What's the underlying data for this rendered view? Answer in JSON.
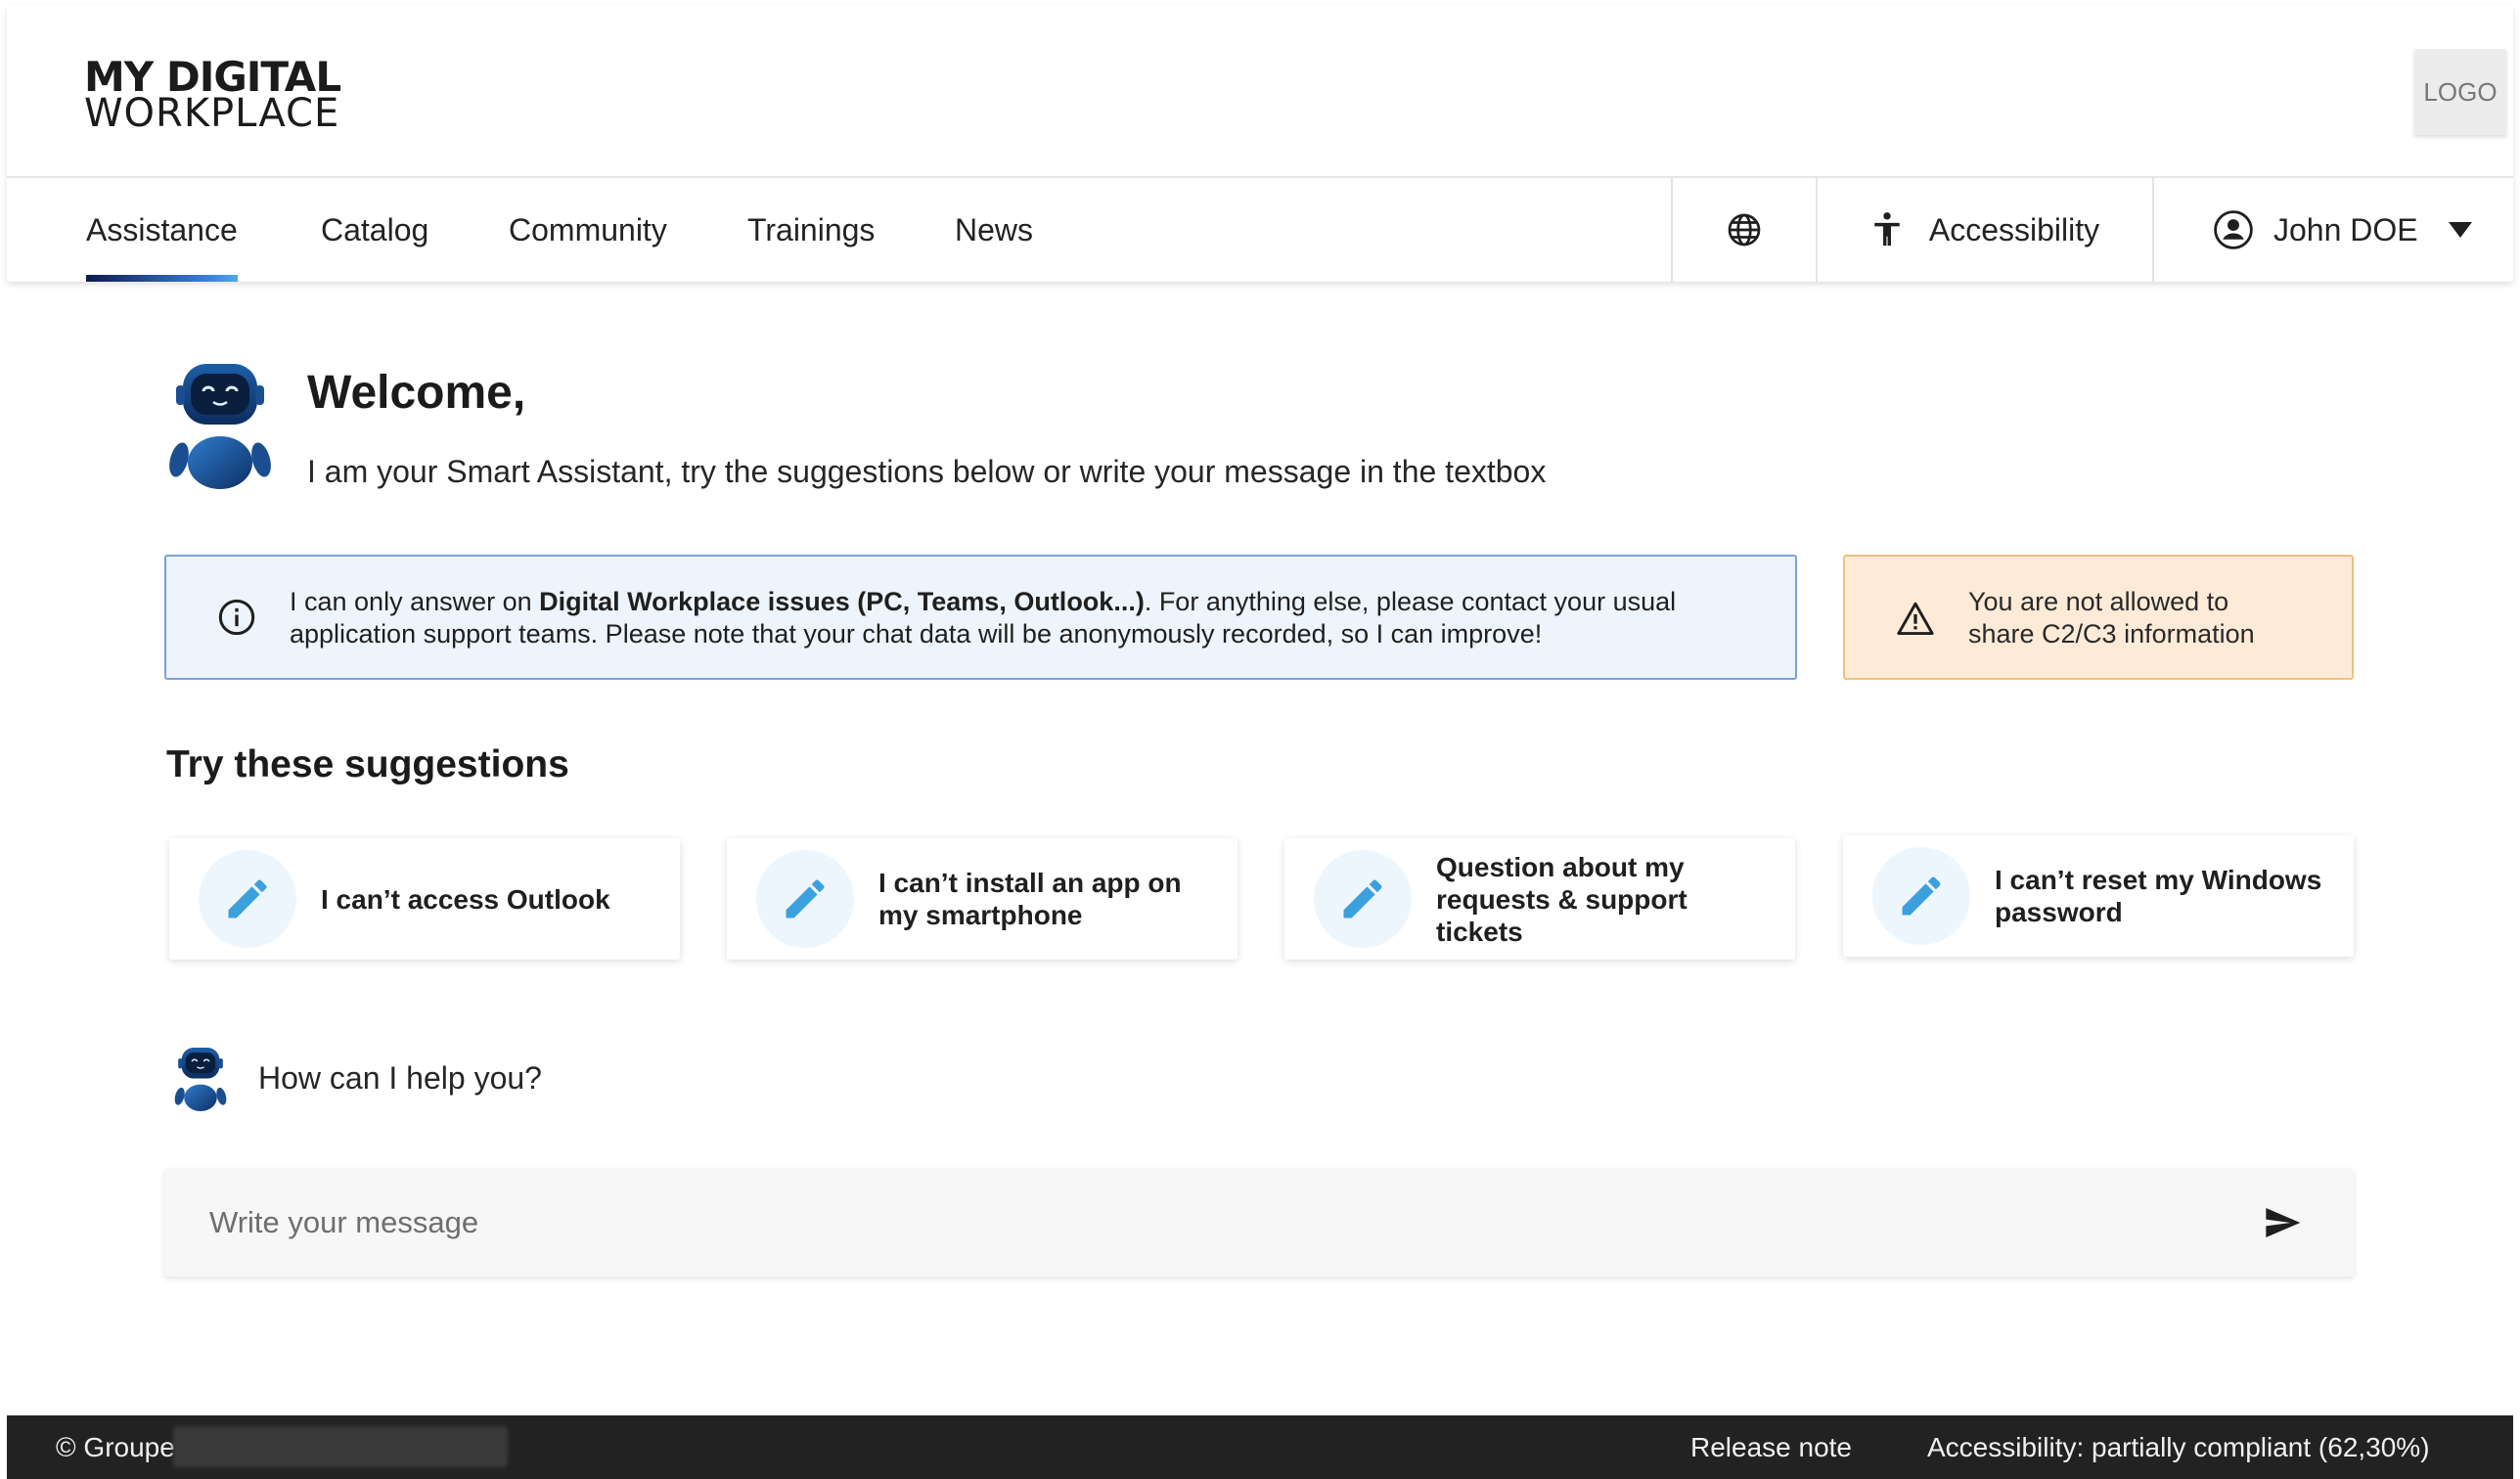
{
  "header": {
    "brand_line1": "MY DIGITAL",
    "brand_line2": "WORKPLACE",
    "logo_label": "LOGO"
  },
  "nav": {
    "items": [
      {
        "label": "Assistance",
        "active": true
      },
      {
        "label": "Catalog",
        "active": false
      },
      {
        "label": "Community",
        "active": false
      },
      {
        "label": "Trainings",
        "active": false
      },
      {
        "label": "News",
        "active": false
      }
    ],
    "language_icon": "globe-icon",
    "accessibility_label": "Accessibility",
    "user_name": "John DOE"
  },
  "welcome": {
    "title": "Welcome,",
    "subtitle": "I am your Smart Assistant, try the suggestions below or write your message in the textbox"
  },
  "info": {
    "prefix": "I can only answer on ",
    "bold": "Digital Workplace issues (PC, Teams, Outlook...)",
    "suffix": ". For anything else, please contact your usual application support teams. Please note that your chat data will be anonymously recorded, so I can improve!"
  },
  "warning": {
    "line1": "You are not allowed to",
    "line2": "share C2/C3 information"
  },
  "suggestions": {
    "title": "Try these suggestions",
    "items": [
      {
        "label": "I can’t access Outlook"
      },
      {
        "label": "I can’t install an app on my smartphone"
      },
      {
        "label": "Question about my requests & support tickets"
      },
      {
        "label": "I can’t reset my Windows password"
      }
    ]
  },
  "chat": {
    "prompt": "How can I help you?",
    "placeholder": "Write your message"
  },
  "footer": {
    "copyright": "© Groupe",
    "release_note": "Release note",
    "accessibility": "Accessibility: partially compliant (62,30%)"
  },
  "colors": {
    "accent_blue": "#3b7fd9",
    "info_bg": "#eef4fc",
    "info_border": "#7aa3d6",
    "warn_bg": "#fdebd7",
    "warn_border": "#efc27e",
    "footer_bg": "#222222",
    "pencil_blue": "#3ba0de"
  }
}
